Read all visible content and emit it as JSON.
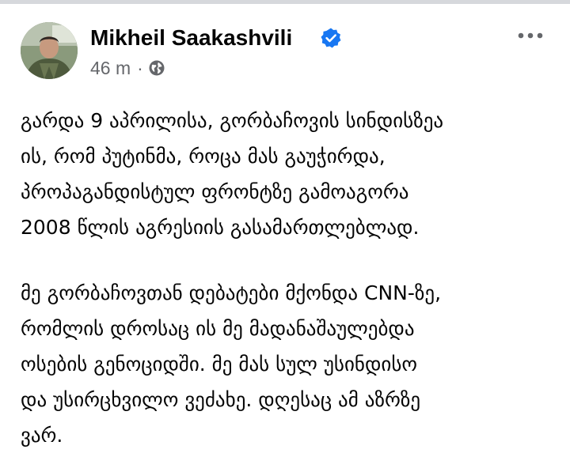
{
  "post": {
    "author_name": "Mikheil Saakashvili",
    "verified_icon": "verified-badge-icon",
    "timestamp": "46 m",
    "separator": "·",
    "audience_icon": "globe-icon",
    "more_icon": "more-options-icon",
    "paragraphs": [
      "გარდა 9 აპრილისა, გორბაჩოვის სინდისზეა\nის, რომ პუტინმა, როცა მას გაუჭირდა,\nპროპაგანდისტულ ფრონტზე გამოაგორა\n2008 წლის აგრესიის გასამართლებლად.",
      "მე გორბაჩოვთან დებატები მქონდა CNN-ზე,\nრომლის დროსაც ის მე მადანაშაულებდა\nოსების გენოციდში. მე მას სულ უსინდისო\nდა უსირცხვილო ვეძახე. დღესაც ამ აზრზე\nვარ."
    ]
  },
  "colors": {
    "text": "#050505",
    "secondary_text": "#65676b",
    "verified_blue": "#1877f2",
    "top_strip": "#d6d8dc"
  }
}
